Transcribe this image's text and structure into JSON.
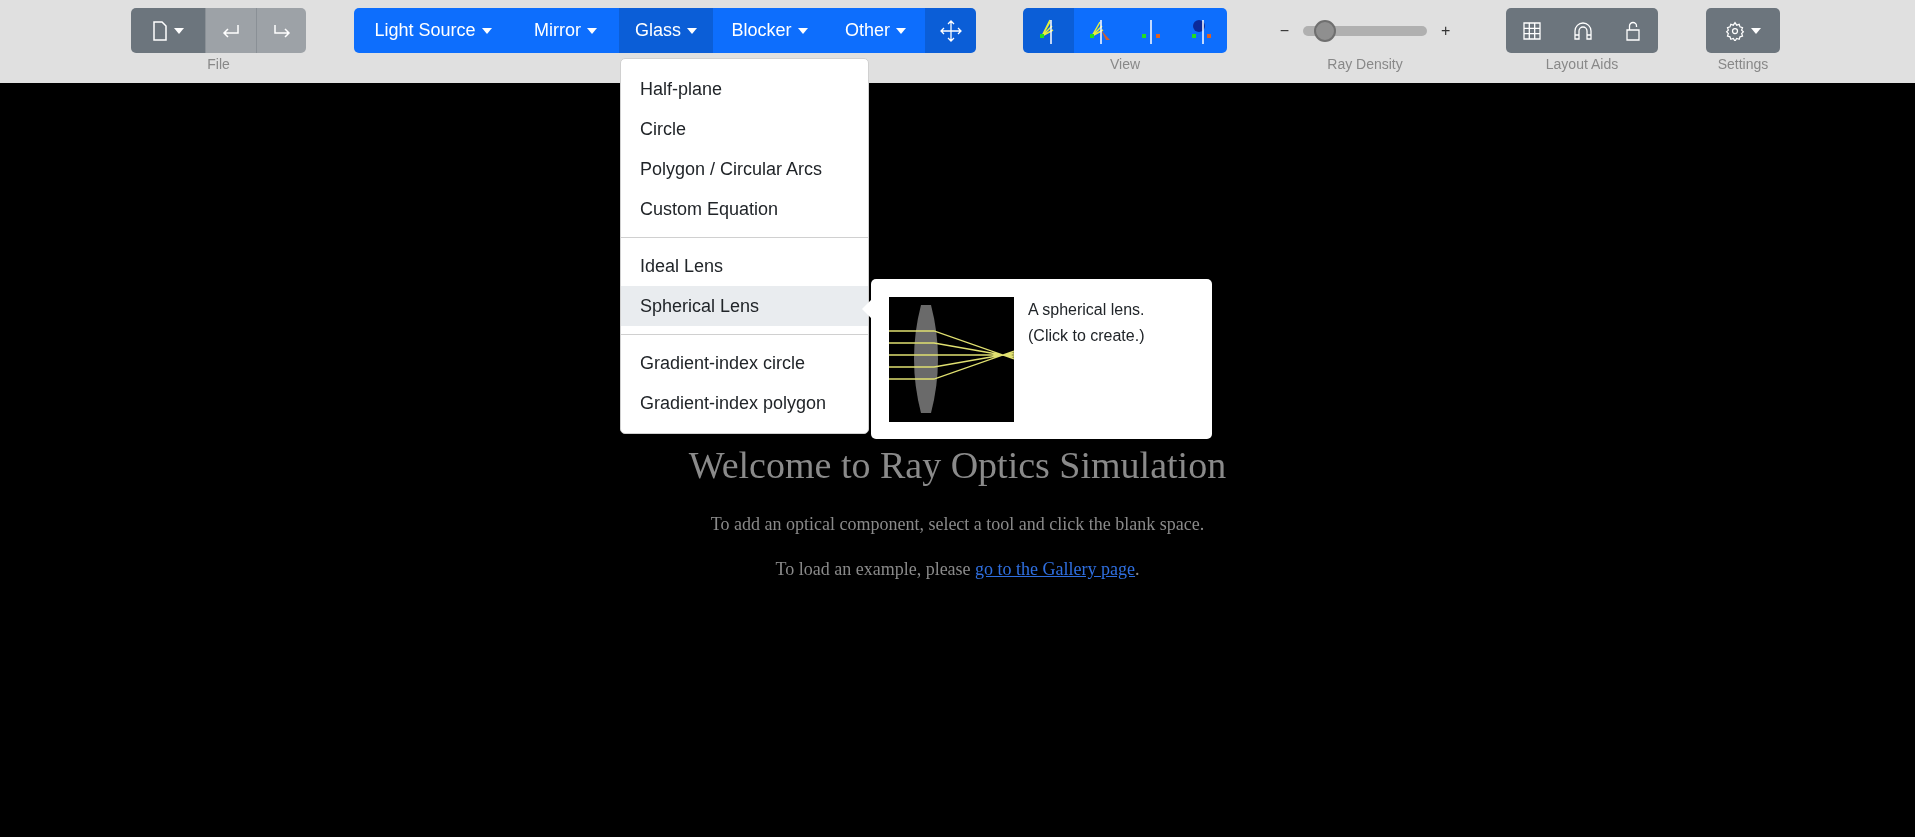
{
  "toolbar": {
    "file": {
      "label": "File",
      "undo": {
        "disabled": true
      },
      "redo": {
        "disabled": true
      }
    },
    "tools": [
      {
        "label": "Light Source",
        "selected": false
      },
      {
        "label": "Mirror",
        "selected": false
      },
      {
        "label": "Glass",
        "selected": true
      },
      {
        "label": "Blocker",
        "selected": false
      },
      {
        "label": "Other",
        "selected": false
      }
    ],
    "move_tool": {
      "selected": true
    },
    "view": {
      "label": "View",
      "modes": [
        {
          "kind": "rays",
          "selected": true
        },
        {
          "kind": "extended",
          "selected": false
        },
        {
          "kind": "images",
          "selected": false
        },
        {
          "kind": "observer",
          "selected": false
        }
      ]
    },
    "ray_density": {
      "label": "Ray Density",
      "minus": "−",
      "plus": "+",
      "level": 0.12
    },
    "layout_aids": {
      "label": "Layout Aids"
    },
    "settings": {
      "label": "Settings"
    }
  },
  "glass_menu": {
    "sections": [
      [
        {
          "label": "Half-plane",
          "selected": false
        },
        {
          "label": "Circle",
          "selected": false
        },
        {
          "label": "Polygon / Circular Arcs",
          "selected": false
        },
        {
          "label": "Custom Equation",
          "selected": false
        }
      ],
      [
        {
          "label": "Ideal Lens",
          "selected": false
        },
        {
          "label": "Spherical Lens",
          "selected": true
        }
      ],
      [
        {
          "label": "Gradient-index circle",
          "selected": false
        },
        {
          "label": "Gradient-index polygon",
          "selected": false
        }
      ]
    ]
  },
  "tooltip": {
    "lines": [
      "A spherical lens.",
      "(Click to create.)"
    ]
  },
  "welcome": {
    "title": "Welcome to Ray Optics Simulation",
    "line1": "To add an optical component, select a tool and click the blank space.",
    "line2_prefix": "To load an example, please ",
    "link": "go to the Gallery page",
    "line2_suffix": "."
  }
}
